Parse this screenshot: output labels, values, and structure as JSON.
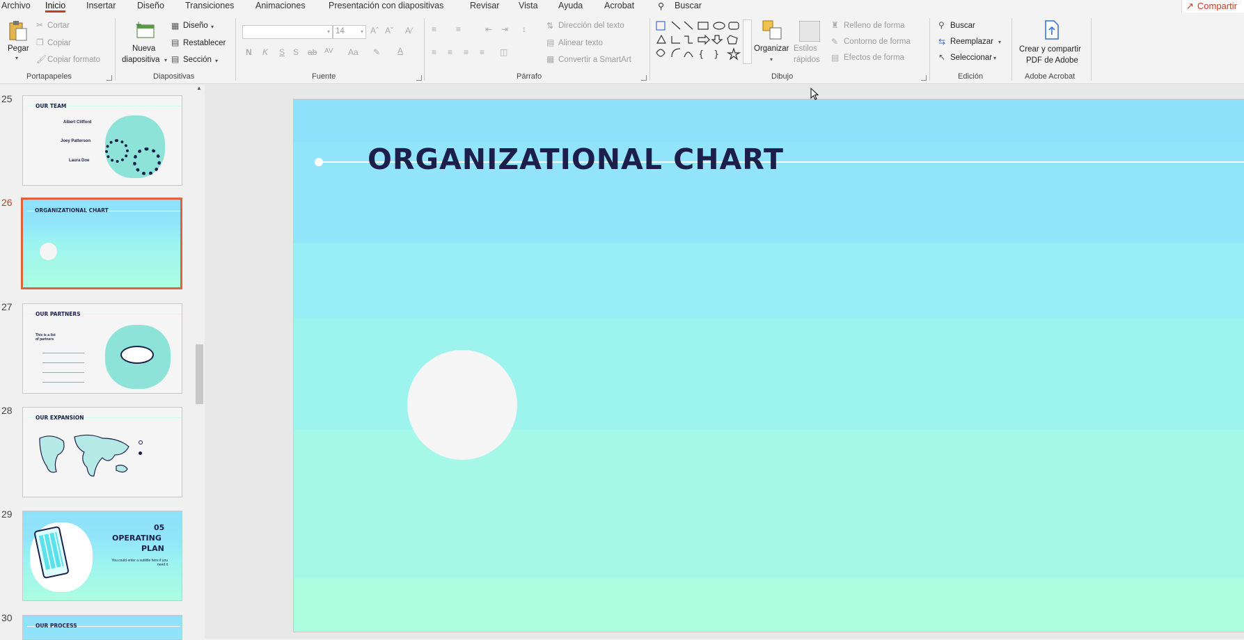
{
  "menu": {
    "tabs": [
      "Archivo",
      "Inicio",
      "Insertar",
      "Diseño",
      "Transiciones",
      "Animaciones",
      "Presentación con diapositivas",
      "Revisar",
      "Vista",
      "Ayuda",
      "Acrobat"
    ],
    "search": "Buscar",
    "share": "Compartir"
  },
  "ribbon": {
    "clipboard": {
      "paste": "Pegar",
      "cut": "Cortar",
      "copy": "Copiar",
      "format_painter": "Copiar formato",
      "label": "Portapapeles"
    },
    "slides": {
      "new_slide_line1": "Nueva",
      "new_slide_line2": "diapositiva",
      "layout": "Diseño",
      "reset": "Restablecer",
      "section": "Sección",
      "label": "Diapositivas"
    },
    "font": {
      "size": "14",
      "bold": "N",
      "italic": "K",
      "underline": "S",
      "shadow": "S",
      "strike": "ab",
      "spacing": "AV",
      "case": "Aa",
      "label": "Fuente"
    },
    "paragraph": {
      "text_direction": "Dirección del texto",
      "align_text": "Alinear texto",
      "smartart": "Convertir a SmartArt",
      "label": "Párrafo"
    },
    "drawing": {
      "arrange": "Organizar",
      "quick_styles_line1": "Estilos",
      "quick_styles_line2": "rápidos",
      "shape_fill": "Relleno de forma",
      "shape_outline": "Contorno de forma",
      "shape_effects": "Efectos de forma",
      "label": "Dibujo"
    },
    "editing": {
      "find": "Buscar",
      "replace": "Reemplazar",
      "select": "Seleccionar",
      "label": "Edición"
    },
    "acrobat": {
      "create_line1": "Crear y compartir",
      "create_line2": "PDF de Adobe",
      "label": "Adobe Acrobat"
    }
  },
  "thumbnails": [
    {
      "num": "25",
      "title": "OUR TEAM",
      "names": [
        "Albert Clifford",
        "Joey Patterson",
        "Laura Doe"
      ]
    },
    {
      "num": "26",
      "title": "ORGANIZATIONAL CHART"
    },
    {
      "num": "27",
      "title": "OUR PARTNERS",
      "sub": "This is a list of partners"
    },
    {
      "num": "28",
      "title": "OUR EXPANSION"
    },
    {
      "num": "29",
      "title": "05",
      "title2": "OPERATING",
      "title3": "PLAN",
      "sub": "You could enter a subtitle here if you need it"
    },
    {
      "num": "30",
      "title": "OUR PROCESS"
    }
  ],
  "slide": {
    "title": "ORGANIZATIONAL CHART"
  },
  "colors": {
    "accent": "#c43e1c",
    "navy": "#1c1f4a",
    "slide_top": "#8fe1fb",
    "slide_bottom": "#acfde0"
  }
}
